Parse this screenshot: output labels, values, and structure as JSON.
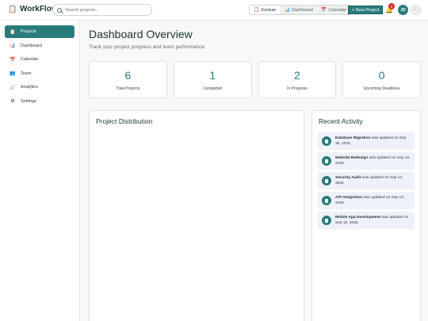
{
  "app": {
    "name": "WorkFlow",
    "logo_icon": "clipboard-icon"
  },
  "search": {
    "placeholder": "Search projects..."
  },
  "views": [
    {
      "label": "Kanban",
      "icon": "clipboard-icon",
      "active": true
    },
    {
      "label": "Dashboard",
      "icon": "bar-chart-icon",
      "active": false
    },
    {
      "label": "Calendar",
      "icon": "calendar-icon",
      "active": false
    }
  ],
  "header": {
    "new_project_label": "+ New Project",
    "notification_count": "3",
    "avatar_initials": "JD",
    "theme_icon": "moon-icon"
  },
  "sidebar": {
    "items": [
      {
        "label": "Projects",
        "icon": "clipboard-icon",
        "active": true
      },
      {
        "label": "Dashboard",
        "icon": "bar-chart-icon",
        "active": false
      },
      {
        "label": "Calendar",
        "icon": "calendar-icon",
        "active": false
      },
      {
        "label": "Team",
        "icon": "team-icon",
        "active": false
      },
      {
        "label": "Analytics",
        "icon": "trend-icon",
        "active": false
      },
      {
        "label": "Settings",
        "icon": "gear-icon",
        "active": false
      }
    ]
  },
  "main": {
    "title": "Dashboard Overview",
    "subtitle": "Track your project progress and team performance",
    "stats": [
      {
        "value": "6",
        "label": "Total Projects"
      },
      {
        "value": "1",
        "label": "Completed"
      },
      {
        "value": "2",
        "label": "In Progress"
      },
      {
        "value": "0",
        "label": "Upcoming Deadlines"
      }
    ],
    "distribution_title": "Project Distribution",
    "activity_title": "Recent Activity",
    "activity": [
      {
        "project": "Database Migration",
        "text": " was updated on Sep 30, 2025"
      },
      {
        "project": "Website Redesign",
        "text": " was updated on Sep 13, 2025"
      },
      {
        "project": "Security Audit",
        "text": " was updated on Sep 13, 2025"
      },
      {
        "project": "API Integration",
        "text": " was updated on Sep 13, 2025"
      },
      {
        "project": "Mobile App Development",
        "text": " was updated on Sep 12, 2025"
      }
    ]
  },
  "colors": {
    "accent": "#2a7c7b",
    "badge": "#d62c2c",
    "activity_bg": "#eef2f8"
  }
}
